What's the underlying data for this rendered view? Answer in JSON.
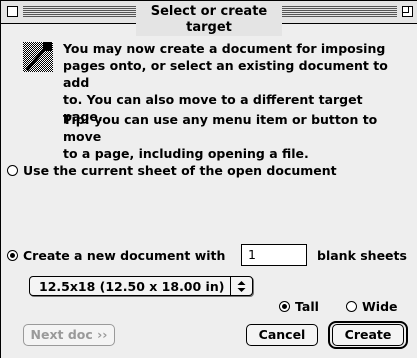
{
  "window": {
    "title": "Select or create target"
  },
  "message": {
    "line1": "You may now create a document for imposing",
    "line2": "pages onto, or select an existing document to add",
    "line3": "to. You can also move to a different target page.",
    "tip1": "Tip: you can use any menu item or button to move",
    "tip2": "to a page, including opening a file.",
    "icon": "imposition-tool-icon"
  },
  "options": {
    "use_current": {
      "label": "Use the current sheet of the open document",
      "selected": false
    },
    "create_new": {
      "label": "Create a new document with",
      "selected": true
    },
    "sheet_count": "1",
    "sheets_suffix": "blank sheets"
  },
  "paper_size": {
    "selected": "12.5x18 (12.50 x 18.00 in)"
  },
  "orientation": {
    "tall": {
      "label": "Tall",
      "selected": true
    },
    "wide": {
      "label": "Wide",
      "selected": false
    }
  },
  "buttons": {
    "next_doc": {
      "label": "Next doc ››",
      "enabled": false
    },
    "cancel": {
      "label": "Cancel"
    },
    "create": {
      "label": "Create",
      "default": true
    }
  }
}
